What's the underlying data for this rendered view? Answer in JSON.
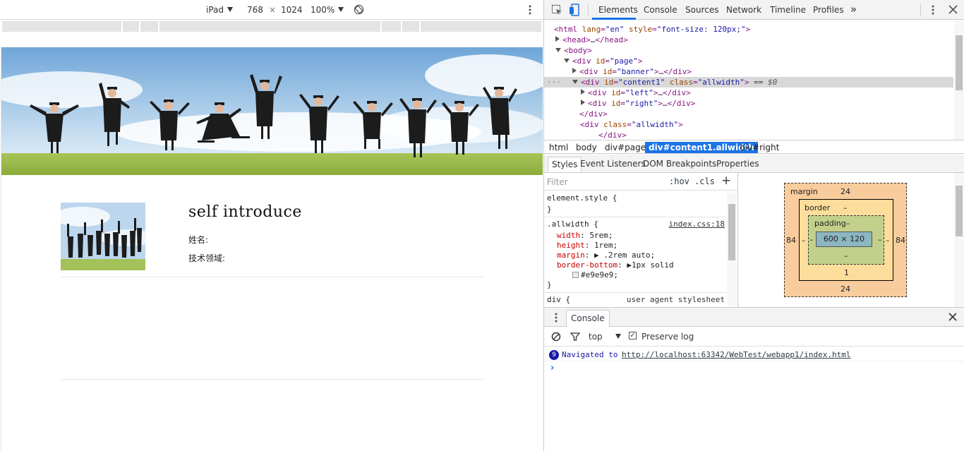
{
  "device_toolbar": {
    "device": "iPad",
    "width": "768",
    "times": "×",
    "height": "1024",
    "zoom": "100%"
  },
  "page": {
    "title": "self introduce",
    "name_label": "姓名:",
    "field_label": "技术领域:"
  },
  "devtools": {
    "tabs": [
      "Elements",
      "Console",
      "Sources",
      "Network",
      "Timeline",
      "Profiles"
    ],
    "more": "»",
    "dom": [
      {
        "text_pre": "<html ",
        "attr": "lang",
        "val": "\"en\"",
        "attr2": "style",
        "val2": "\"font-size: 120px;\"",
        "end": ">"
      },
      {
        "collapsed": "<head>…</head>"
      },
      {
        "open": "<body>"
      },
      {
        "open_div": "<div ",
        "attr": "id",
        "val": "\"page\"",
        "end": ">"
      },
      {
        "line": "<div ",
        "attr": "id",
        "val": "\"banner\"",
        "end": ">…</div>"
      },
      {
        "line": "<div ",
        "attr": "id",
        "val": "\"content1\"",
        "attr2": "class",
        "val2": "\"allwidth\"",
        "end": ">",
        "suffix": " == $0"
      },
      {
        "line": "<div ",
        "attr": "id",
        "val": "\"left\"",
        "end": ">…</div>"
      },
      {
        "line": "<div ",
        "attr": "id",
        "val": "\"right\"",
        "end": ">…</div>"
      },
      {
        "close": "</div>"
      },
      {
        "line": "<div ",
        "attr": "class",
        "val": "\"allwidth\"",
        "end": ">"
      },
      {
        "close": "</div>"
      }
    ],
    "breadcrumbs": [
      "html",
      "body",
      "div#page",
      "div#content1.allwidth",
      "div#right"
    ],
    "sub_tabs": [
      "Styles",
      "Event Listeners",
      "DOM Breakpoints",
      "Properties"
    ],
    "filter_placeholder": "Filter",
    "hov": ":hov",
    "cls": ".cls",
    "plus": "+",
    "styles": {
      "element_style": "element.style {",
      "close": "}",
      "rule_selector": ".allwidth {",
      "rule_source": "index.css:18",
      "props": [
        {
          "name": "width",
          "value": "5rem;"
        },
        {
          "name": "height",
          "value": "1rem;"
        },
        {
          "name": "margin",
          "value": "▶ .2rem auto;"
        },
        {
          "name": "border-bottom",
          "value": "▶1px solid"
        }
      ],
      "color_value": "#e9e9e9;",
      "ua_selector": "div {",
      "ua_source": "user agent stylesheet"
    },
    "box_model": {
      "margin_label": "margin",
      "margin_top": "24",
      "margin_bottom": "24",
      "margin_left": "84",
      "margin_right": "84",
      "border_label": "border",
      "border_top": "–",
      "border_bottom": "1",
      "border_left": "–",
      "border_right": "–",
      "padding_label": "padding–",
      "padding_bottom": "–",
      "padding_left": "–",
      "padding_right": "–",
      "content_size": "600 × 120"
    },
    "console": {
      "tab": "Console",
      "context": "top",
      "preserve_log": "Preserve log",
      "badge": "9",
      "message_prefix": "Navigated to ",
      "message_link": "http://localhost:63342/WebTest/webapp1/index.html",
      "prompt": "›"
    }
  }
}
